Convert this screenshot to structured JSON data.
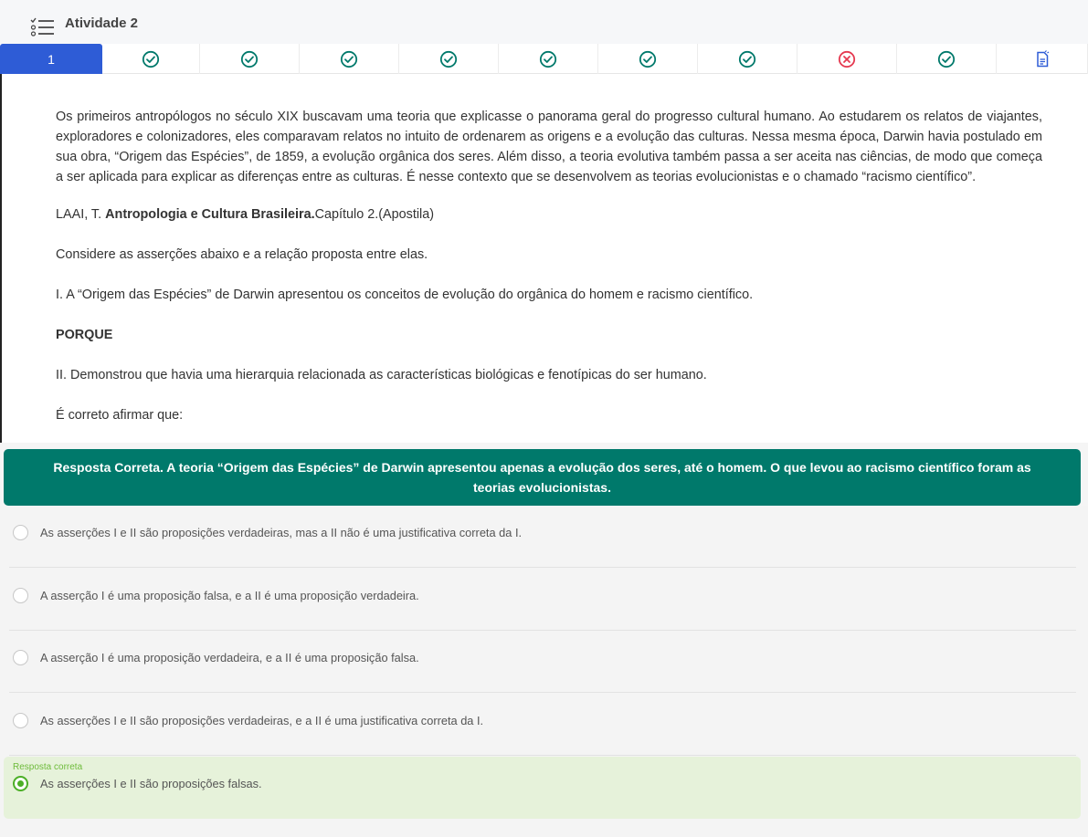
{
  "header": {
    "title": "Atividade 2",
    "icon": "checklist-icon"
  },
  "tabs": [
    {
      "label": "1",
      "status": "active"
    },
    {
      "status": "correct",
      "icon": "check-circle-icon"
    },
    {
      "status": "correct",
      "icon": "check-circle-icon"
    },
    {
      "status": "correct",
      "icon": "check-circle-icon"
    },
    {
      "status": "correct",
      "icon": "check-circle-icon"
    },
    {
      "status": "correct",
      "icon": "check-circle-icon"
    },
    {
      "status": "correct",
      "icon": "check-circle-icon"
    },
    {
      "status": "correct",
      "icon": "check-circle-icon"
    },
    {
      "status": "wrong",
      "icon": "x-circle-icon"
    },
    {
      "status": "correct",
      "icon": "check-circle-icon"
    },
    {
      "status": "summary",
      "icon": "document-icon"
    }
  ],
  "colors": {
    "active_tab": "#2e5cd6",
    "correct": "#00796b",
    "wrong": "#e53950",
    "feedback_bg": "#00796b",
    "correct_option_bg": "#e6f2da",
    "correct_radio": "#4caf27"
  },
  "question": {
    "paragraph": "Os primeiros antropólogos no século XIX buscavam uma teoria que explicasse o panorama geral do progresso cultural humano. Ao estudarem os relatos de viajantes, exploradores e colonizadores, eles comparavam relatos no intuito de ordenarem as origens e a evolução das culturas. Nessa mesma época, Darwin havia postulado em sua obra, “Origem das Espécies”, de 1859, a evolução orgânica dos seres. Além disso, a teoria evolutiva também passa a ser aceita nas ciências, de modo que começa a ser aplicada para explicar as diferenças entre as culturas. É nesse contexto que se desenvolvem as teorias evolucionistas e o chamado “racismo científico”.",
    "citation_author": "LAAI, T. ",
    "citation_title": "Antropologia e Cultura Brasileira.",
    "citation_rest": "Capítulo 2.(Apostila)",
    "instruction": " Considere as asserções abaixo e a relação proposta entre elas.",
    "assertion_1": "I. A “Origem das Espécies” de Darwin apresentou os conceitos de evolução do orgânica do homem e racismo científico.",
    "connector": "PORQUE",
    "assertion_2": "II. Demonstrou que havia uma hierarquia relacionada as características biológicas e fenotípicas do ser humano.",
    "prompt": "É correto afirmar que:"
  },
  "feedback": "Resposta Correta. A teoria “Origem das Espécies” de Darwin apresentou apenas a evolução dos seres, até o homem. O que levou ao racismo científico foram as teorias evolucionistas.",
  "options": [
    {
      "label": "As asserções I e II são proposições verdadeiras, mas a II não é uma justificativa correta da I."
    },
    {
      "label": "A asserção I é uma proposição falsa, e a II é uma proposição verdadeira."
    },
    {
      "label": "A asserção I é uma proposição verdadeira, e a II é uma proposição falsa."
    },
    {
      "label": "As asserções I e II são proposições verdadeiras, e a II é uma justificativa correta da I."
    },
    {
      "label": "As asserções I e II são proposições falsas.",
      "tag": "Resposta correta",
      "selected": true
    }
  ]
}
